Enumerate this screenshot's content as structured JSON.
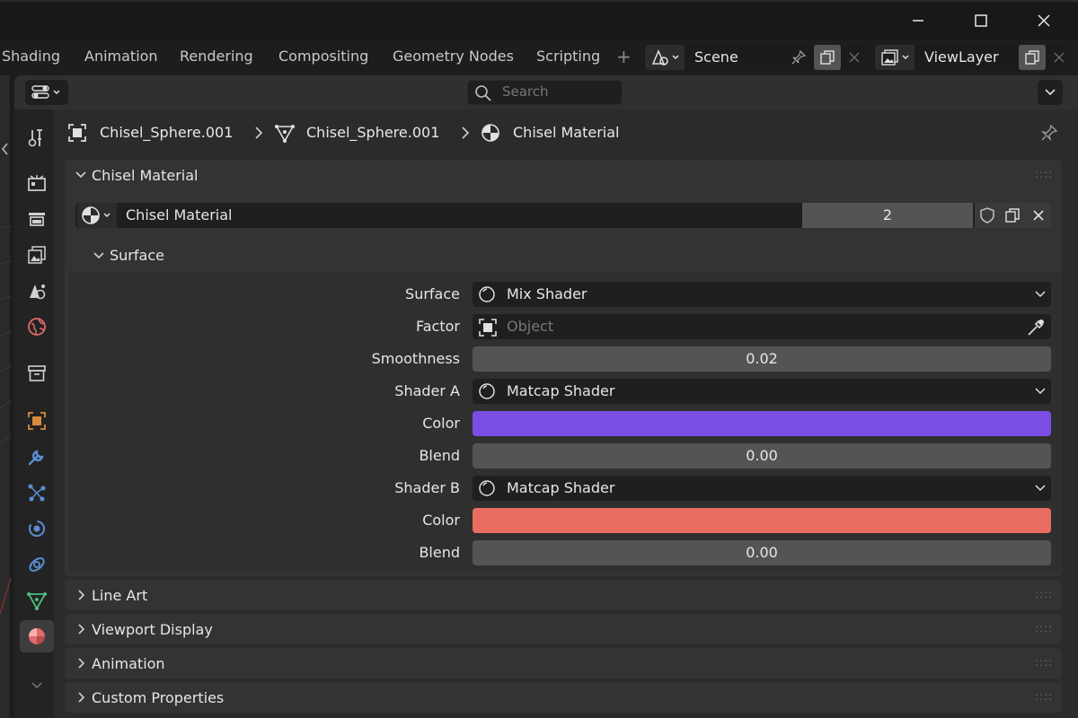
{
  "window": {
    "minimize_icon": "minimize-icon",
    "maximize_icon": "maximize-icon",
    "close_icon": "close-icon"
  },
  "workspace_tabs": [
    "Shading",
    "Animation",
    "Rendering",
    "Compositing",
    "Geometry Nodes",
    "Scripting"
  ],
  "add_tab_label": "+",
  "scene": {
    "label": "Scene"
  },
  "view_layer": {
    "label": "ViewLayer"
  },
  "search": {
    "placeholder": "Search"
  },
  "breadcrumb": {
    "object": "Chisel_Sphere.001",
    "mesh": "Chisel_Sphere.001",
    "material": "Chisel Material"
  },
  "material_panel": {
    "title": "Chisel Material",
    "material_name": "Chisel Material",
    "users": "2"
  },
  "surface_panel": {
    "title": "Surface",
    "rows": {
      "surface": {
        "label": "Surface",
        "value": "Mix Shader"
      },
      "factor": {
        "label": "Factor",
        "placeholder": "Object"
      },
      "smoothness": {
        "label": "Smoothness",
        "value": "0.02"
      },
      "shader_a": {
        "label": "Shader A",
        "value": "Matcap Shader"
      },
      "color_a": {
        "label": "Color",
        "color": "#7a4ee3"
      },
      "blend_a": {
        "label": "Blend",
        "value": "0.00"
      },
      "shader_b": {
        "label": "Shader B",
        "value": "Matcap Shader"
      },
      "color_b": {
        "label": "Color",
        "color": "#e96d60"
      },
      "blend_b": {
        "label": "Blend",
        "value": "0.00"
      }
    }
  },
  "collapsed_panels": [
    "Line Art",
    "Viewport Display",
    "Animation",
    "Custom Properties"
  ],
  "colors": {
    "accent_blue": "#5a8fd8",
    "object_orange": "#d98a3a",
    "material_red": "#e06a6a",
    "data_green": "#4fbf7f"
  }
}
